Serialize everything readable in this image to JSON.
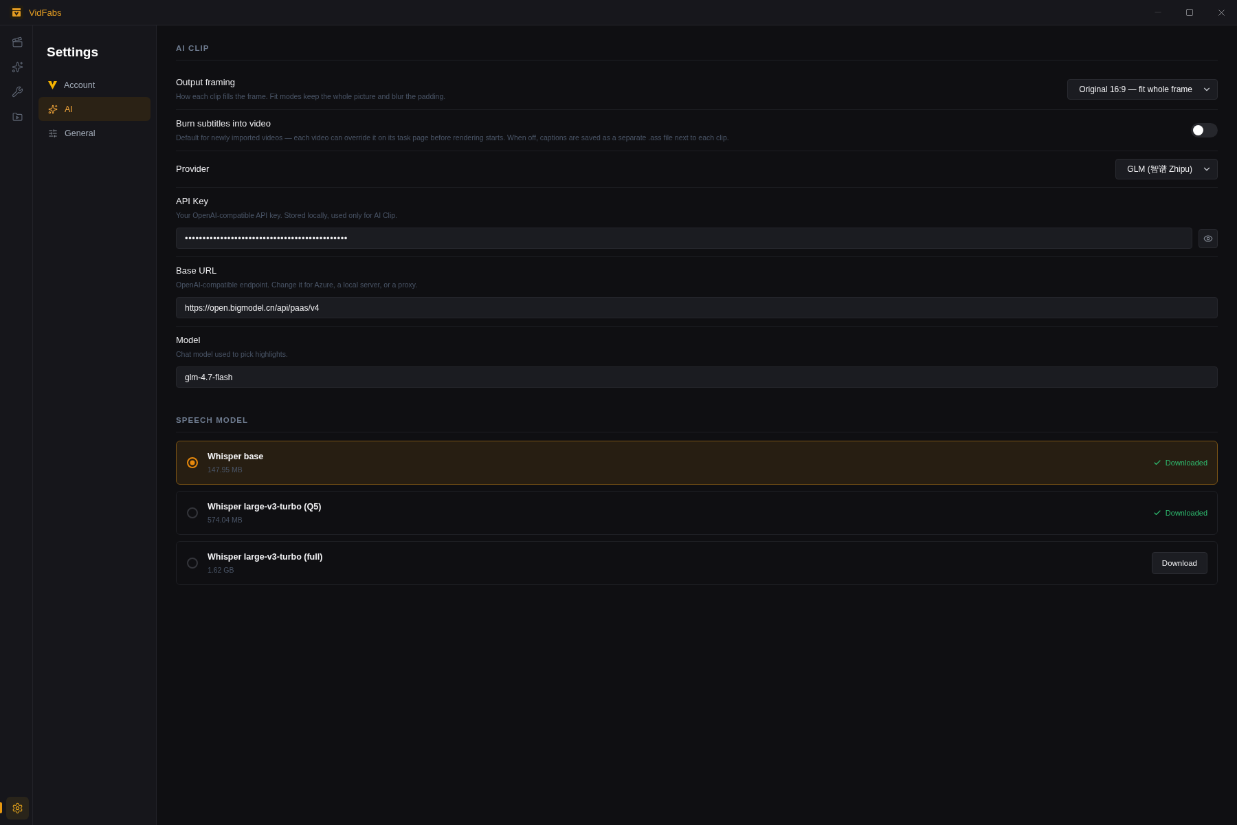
{
  "app": {
    "title": "VidFabs"
  },
  "rail": {
    "items": [
      {
        "selected": false
      },
      {
        "selected": false
      },
      {
        "selected": false
      },
      {
        "selected": false
      }
    ],
    "footer": {
      "selected": true
    }
  },
  "settings_nav": {
    "title": "Settings",
    "items": [
      {
        "label": "Account",
        "selected": false
      },
      {
        "label": "AI",
        "selected": true
      },
      {
        "label": "General",
        "selected": false
      }
    ]
  },
  "sections": [
    {
      "heading": "AI CLIP",
      "rows": [
        {
          "kind": "select",
          "label": "Output framing",
          "description": "How each clip fills the frame. Fit modes keep the whole picture and blur the padding.",
          "value": "Original 16:9 — fit whole frame"
        },
        {
          "kind": "toggle",
          "label": "Burn subtitles into video",
          "description": "Default for newly imported videos — each video can override it on its task page before rendering starts. When off, captions are saved as a separate .ass file next to each clip.",
          "on": false
        },
        {
          "kind": "select",
          "label": "Provider",
          "value": "GLM (智谱 Zhipu)"
        },
        {
          "kind": "secret",
          "label": "API Key",
          "description": "Your OpenAI-compatible API key. Stored locally, used only for AI Clip.",
          "value": "••••••••••••••••••••••••••••••••••••••••••••••"
        },
        {
          "kind": "text",
          "label": "Base URL",
          "description": "OpenAI-compatible endpoint. Change it for Azure, a local server, or a proxy.",
          "value": "https://open.bigmodel.cn/api/paas/v4"
        },
        {
          "kind": "text",
          "label": "Model",
          "description": "Chat model used to pick highlights.",
          "value": "glm-4.7-flash"
        }
      ]
    },
    {
      "heading": "SPEECH MODEL",
      "models": [
        {
          "name": "Whisper base",
          "size": "147.95 MB",
          "selected": true,
          "status": {
            "kind": "downloaded",
            "label": "Downloaded"
          }
        },
        {
          "name": "Whisper large-v3-turbo (Q5)",
          "size": "574.04 MB",
          "selected": false,
          "status": {
            "kind": "downloaded",
            "label": "Downloaded"
          }
        },
        {
          "name": "Whisper large-v3-turbo (full)",
          "size": "1.62 GB",
          "selected": false,
          "status": {
            "kind": "download",
            "label": "Download"
          }
        }
      ]
    }
  ]
}
